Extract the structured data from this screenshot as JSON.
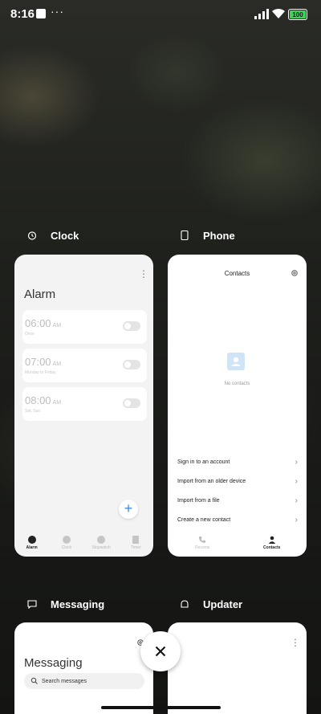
{
  "status_bar": {
    "time": "8:16",
    "dots": "···",
    "battery": "100",
    "battery_color": "#3ad45a"
  },
  "apps": {
    "clock": {
      "name": "Clock",
      "screen_title": "Alarm",
      "alarms": [
        {
          "time": "06:00",
          "ampm": "AM",
          "sub": "Once"
        },
        {
          "time": "07:00",
          "ampm": "AM",
          "sub": "Monday to Friday"
        },
        {
          "time": "08:00",
          "ampm": "AM",
          "sub": "Sat, Sun"
        }
      ],
      "fab": "+",
      "nav": [
        "Alarm",
        "Clock",
        "Stopwatch",
        "Timer"
      ]
    },
    "phone": {
      "name": "Phone",
      "screen_title": "Contacts",
      "empty_text": "No contacts",
      "options": [
        "Sign in to an account",
        "Import from an older device",
        "Import from a file",
        "Create a new contact"
      ],
      "nav": [
        "Recents",
        "Contacts"
      ]
    },
    "messaging": {
      "name": "Messaging",
      "screen_title": "Messaging",
      "search_placeholder": "Search messages"
    },
    "updater": {
      "name": "Updater"
    }
  },
  "accent_color": "#3a8ee6"
}
